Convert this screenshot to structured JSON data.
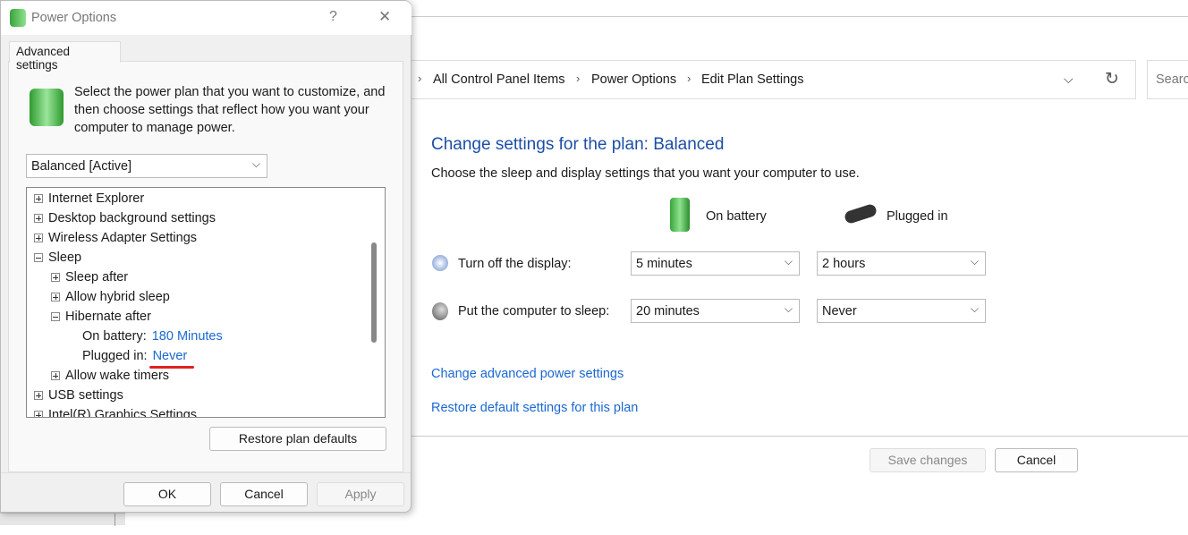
{
  "main": {
    "breadcrumb": [
      "All Control Panel Items",
      "Power Options",
      "Edit Plan Settings"
    ],
    "search_placeholder": "Search",
    "heading": "Change settings for the plan: Balanced",
    "subheading": "Choose the sleep and display settings that you want your computer to use.",
    "col_battery": "On battery",
    "col_plugged": "Plugged in",
    "rows": [
      {
        "label": "Turn off the display:",
        "battery": "5 minutes",
        "plugged": "2 hours",
        "icon": "display-clock-icon"
      },
      {
        "label": "Put the computer to sleep:",
        "battery": "20 minutes",
        "plugged": "Never",
        "icon": "sleep-moon-icon"
      }
    ],
    "link_advanced": "Change advanced power settings",
    "link_restore": "Restore default settings for this plan",
    "save": "Save changes",
    "cancel": "Cancel"
  },
  "dialog": {
    "title": "Power Options",
    "help": "?",
    "close": "✕",
    "tab": "Advanced settings",
    "intro": "Select the power plan that you want to customize, and then choose settings that reflect how you want your computer to manage power.",
    "plan": "Balanced [Active]",
    "tree": [
      {
        "label": "Internet Explorer",
        "level": 0,
        "state": "plus"
      },
      {
        "label": "Desktop background settings",
        "level": 0,
        "state": "plus"
      },
      {
        "label": "Wireless Adapter Settings",
        "level": 0,
        "state": "plus"
      },
      {
        "label": "Sleep",
        "level": 0,
        "state": "minus"
      },
      {
        "label": "Sleep after",
        "level": 1,
        "state": "plus"
      },
      {
        "label": "Allow hybrid sleep",
        "level": 1,
        "state": "plus"
      },
      {
        "label": "Hibernate after",
        "level": 1,
        "state": "minus"
      },
      {
        "label": "On battery:",
        "value": "180 Minutes",
        "level": 2
      },
      {
        "label": "Plugged in:",
        "value": "Never",
        "level": 2
      },
      {
        "label": "Allow wake timers",
        "level": 1,
        "state": "plus"
      },
      {
        "label": "USB settings",
        "level": 0,
        "state": "plus"
      },
      {
        "label": "Intel(R) Graphics Settings",
        "level": 0,
        "state": "plus"
      }
    ],
    "restore": "Restore plan defaults",
    "ok": "OK",
    "cancel": "Cancel",
    "apply": "Apply",
    "annotation_color": "#e02020",
    "link_color": "#1a68d0"
  }
}
